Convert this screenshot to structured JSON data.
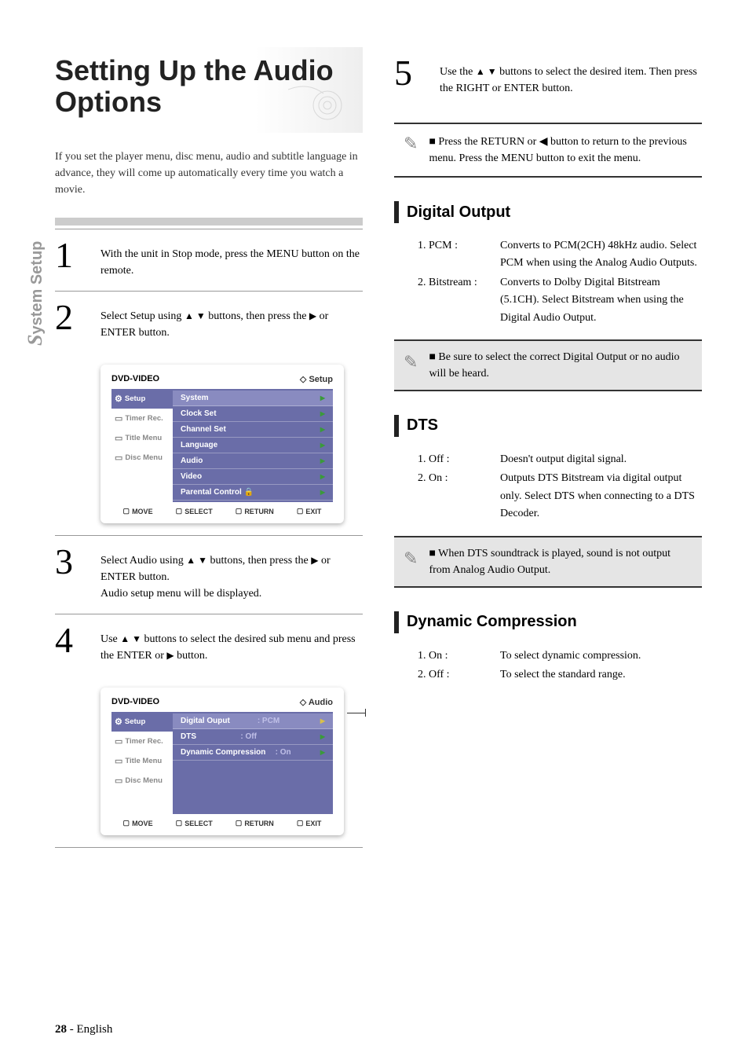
{
  "sideTab": {
    "s": "S",
    "rest": "ystem Setup"
  },
  "title": "Setting Up the Audio Options",
  "intro": "If you set the player menu, disc menu, audio and subtitle language in advance, they will come up automatically every time you watch a movie.",
  "steps": {
    "s1": {
      "num": "1",
      "text": "With the unit in Stop mode, press the MENU button on the remote."
    },
    "s2": {
      "num": "2",
      "text_a": "Select Setup using ",
      "text_b": " buttons, then press the ",
      "text_c": " or ENTER button."
    },
    "s3": {
      "num": "3",
      "text_a": "Select Audio using ",
      "text_b": " buttons, then press the ",
      "text_c": " or ENTER button.",
      "extra": "Audio setup menu will be displayed."
    },
    "s4": {
      "num": "4",
      "text_a": "Use ",
      "text_b": " buttons to select the desired sub menu and press the ENTER or ",
      "text_c": " button."
    },
    "s5": {
      "num": "5",
      "text_a": "Use the ",
      "text_b": " buttons to select the desired item. Then press the RIGHT or ENTER button."
    }
  },
  "ss1": {
    "header_left": "DVD-VIDEO",
    "header_right": "Setup",
    "side": {
      "setup": "Setup",
      "timer": "Timer Rec.",
      "title": "Title Menu",
      "disc": "Disc Menu"
    },
    "rows": {
      "r0": "System",
      "r1": "Clock Set",
      "r2": "Channel Set",
      "r3": "Language",
      "r4": "Audio",
      "r5": "Video",
      "r6": "Parental Control"
    },
    "foot": {
      "m": "MOVE",
      "s": "SELECT",
      "r": "RETURN",
      "e": "EXIT"
    }
  },
  "ss2": {
    "header_left": "DVD-VIDEO",
    "header_right": "Audio",
    "rows": {
      "r0l": "Digital Ouput",
      "r0v": ": PCM",
      "r1l": "DTS",
      "r1v": ": Off",
      "r2l": "Dynamic Compression",
      "r2v": ": On"
    }
  },
  "notes": {
    "n1": "Press the RETURN or ◀ button to return to the previous menu. Press the MENU button to exit the menu.",
    "n2": "Be sure to select the correct Digital Output or no audio will be heard.",
    "n3": "When DTS soundtrack is played, sound is not output from Analog Audio Output."
  },
  "sections": {
    "digital": {
      "title": "Digital Output",
      "items": {
        "i1l": "1. PCM :",
        "i1d": "Converts to PCM(2CH) 48kHz audio. Select PCM when using the Analog Audio Outputs.",
        "i2l": "2. Bitstream :",
        "i2d": "Converts to Dolby Digital Bitstream (5.1CH). Select Bitstream when using the Digital Audio Output."
      }
    },
    "dts": {
      "title": "DTS",
      "items": {
        "i1l": "1. Off :",
        "i1d": "Doesn't output digital signal.",
        "i2l": "2. On :",
        "i2d": "Outputs DTS Bitstream via digital output only. Select DTS when connecting to a DTS Decoder."
      }
    },
    "dyn": {
      "title": "Dynamic Compression",
      "items": {
        "i1l": "1. On :",
        "i1d": "To select dynamic compression.",
        "i2l": "2. Off :",
        "i2d": "To select the standard range."
      }
    }
  },
  "footer": {
    "page": "28",
    "sep": " - ",
    "lang": "English"
  },
  "glyphs": {
    "updown": "▲ ▼",
    "right": "▶",
    "left": "◀"
  }
}
